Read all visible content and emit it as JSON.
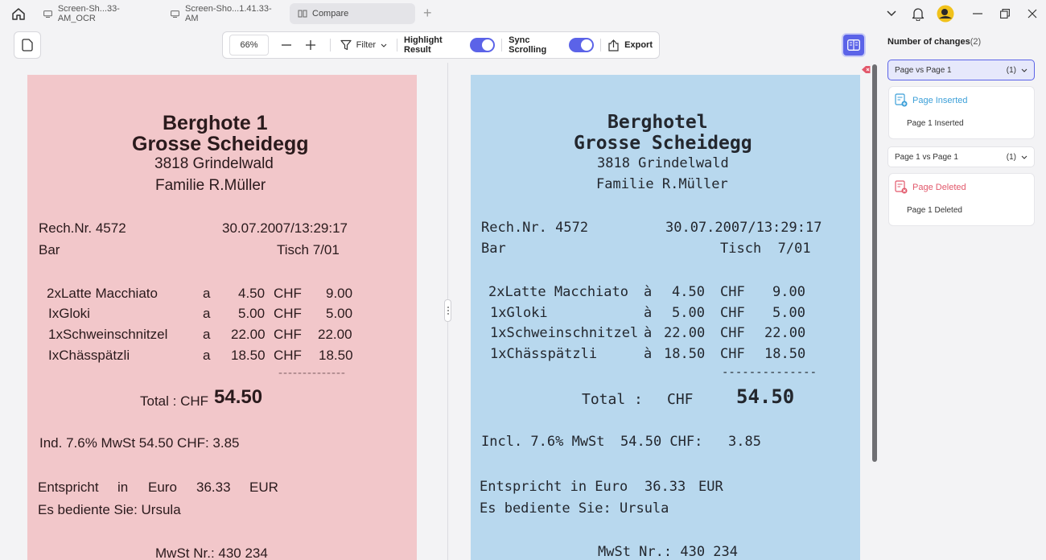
{
  "tabs": [
    {
      "label": "Screen-Sh...33-AM_OCR"
    },
    {
      "label": "Screen-Sho...1.41.33-AM"
    },
    {
      "label": "Compare"
    }
  ],
  "toolbar": {
    "zoom": "66%",
    "filter_label": "Filter",
    "highlight_label": "Highlight Result",
    "sync_label": "Sync Scrolling",
    "export_label": "Export"
  },
  "sidebar": {
    "title": "Number of changes",
    "count": "(2)",
    "groups": [
      {
        "label": "Page  vs Page 1",
        "count": "(1)",
        "change_title": "Page Inserted",
        "change_detail": "Page 1 Inserted"
      },
      {
        "label": "Page 1 vs Page 1",
        "count": "(1)",
        "change_title": "Page Deleted",
        "change_detail": "Page 1 Deleted"
      }
    ]
  },
  "left_doc": {
    "hotel1": "Berghote 1",
    "hotel2": "Grosse Scheidegg",
    "city": "3818 Grindelwald",
    "family": "Familie R.Müller",
    "rech": "Rech.Nr. 4572",
    "date": "30.07.2007/13:29:17",
    "bar": "Bar",
    "tisch": "Tisch 7/01",
    "items": [
      {
        "name": "2xLatte Macchiato",
        "a": "a",
        "price": "4.50",
        "cur": "CHF",
        "total": "9.00"
      },
      {
        "name": "IxGloki",
        "a": "a",
        "price": "5.00",
        "cur": "CHF",
        "total": "5.00"
      },
      {
        "name": "1xSchweinschnitzel",
        "a": "a",
        "price": "22.00",
        "cur": "CHF",
        "total": "22.00"
      },
      {
        "name": "IxChässpätzli",
        "a": "a",
        "price": "18.50",
        "cur": "CHF",
        "total": "18.50"
      }
    ],
    "dashes": "--------------",
    "total_label": "Total : CHF",
    "total_value": "54.50",
    "mwst": "Ind. 7.6% MwSt 54.50 CHF: 3.85",
    "euro_label": "Entspricht",
    "euro_in": "in",
    "euro_word": "Euro",
    "euro_value": "36.33",
    "euro_cur": "EUR",
    "served": "Es bediente Sie: Ursula",
    "mwst_nr": "MwSt Nr.: 430 234"
  },
  "right_doc": {
    "hotel1": "Berghotel",
    "hotel2": "Grosse Scheidegg",
    "city": "3818 Grindelwald",
    "family": "Familie R.Müller",
    "rech": "Rech.Nr. 4572",
    "date": "30.07.2007/13:29:17",
    "bar": "Bar",
    "tisch": "Tisch  7/01",
    "items": [
      {
        "name": "2xLatte Macchiato",
        "a": "à",
        "price": "4.50",
        "cur": "CHF",
        "total": "9.00"
      },
      {
        "name": "1xGloki",
        "a": "à",
        "price": "5.00",
        "cur": "CHF",
        "total": "5.00"
      },
      {
        "name": "1xSchweinschnitzel",
        "a": "à",
        "price": "22.00",
        "cur": "CHF",
        "total": "22.00"
      },
      {
        "name": "1xChässpätzli",
        "a": "à",
        "price": "18.50",
        "cur": "CHF",
        "total": "18.50"
      }
    ],
    "dashes": "--------------",
    "total_label": "Total :",
    "total_cur": "CHF",
    "total_value": "54.50",
    "mwst": "Incl. 7.6% MwSt",
    "mwst_value": "54.50 CHF:",
    "mwst_tax": "3.85",
    "euro": "Entspricht in Euro",
    "euro_value": "36.33",
    "euro_cur": "EUR",
    "served": "Es bediente Sie: Ursula",
    "mwst_nr": "MwSt Nr.: 430 234"
  },
  "colors": {
    "accent": "#5b63e8",
    "left_page": "#f2c7ca",
    "right_page": "#b8d8ee",
    "inserted": "#3b9fd8",
    "deleted": "#e2586b"
  }
}
